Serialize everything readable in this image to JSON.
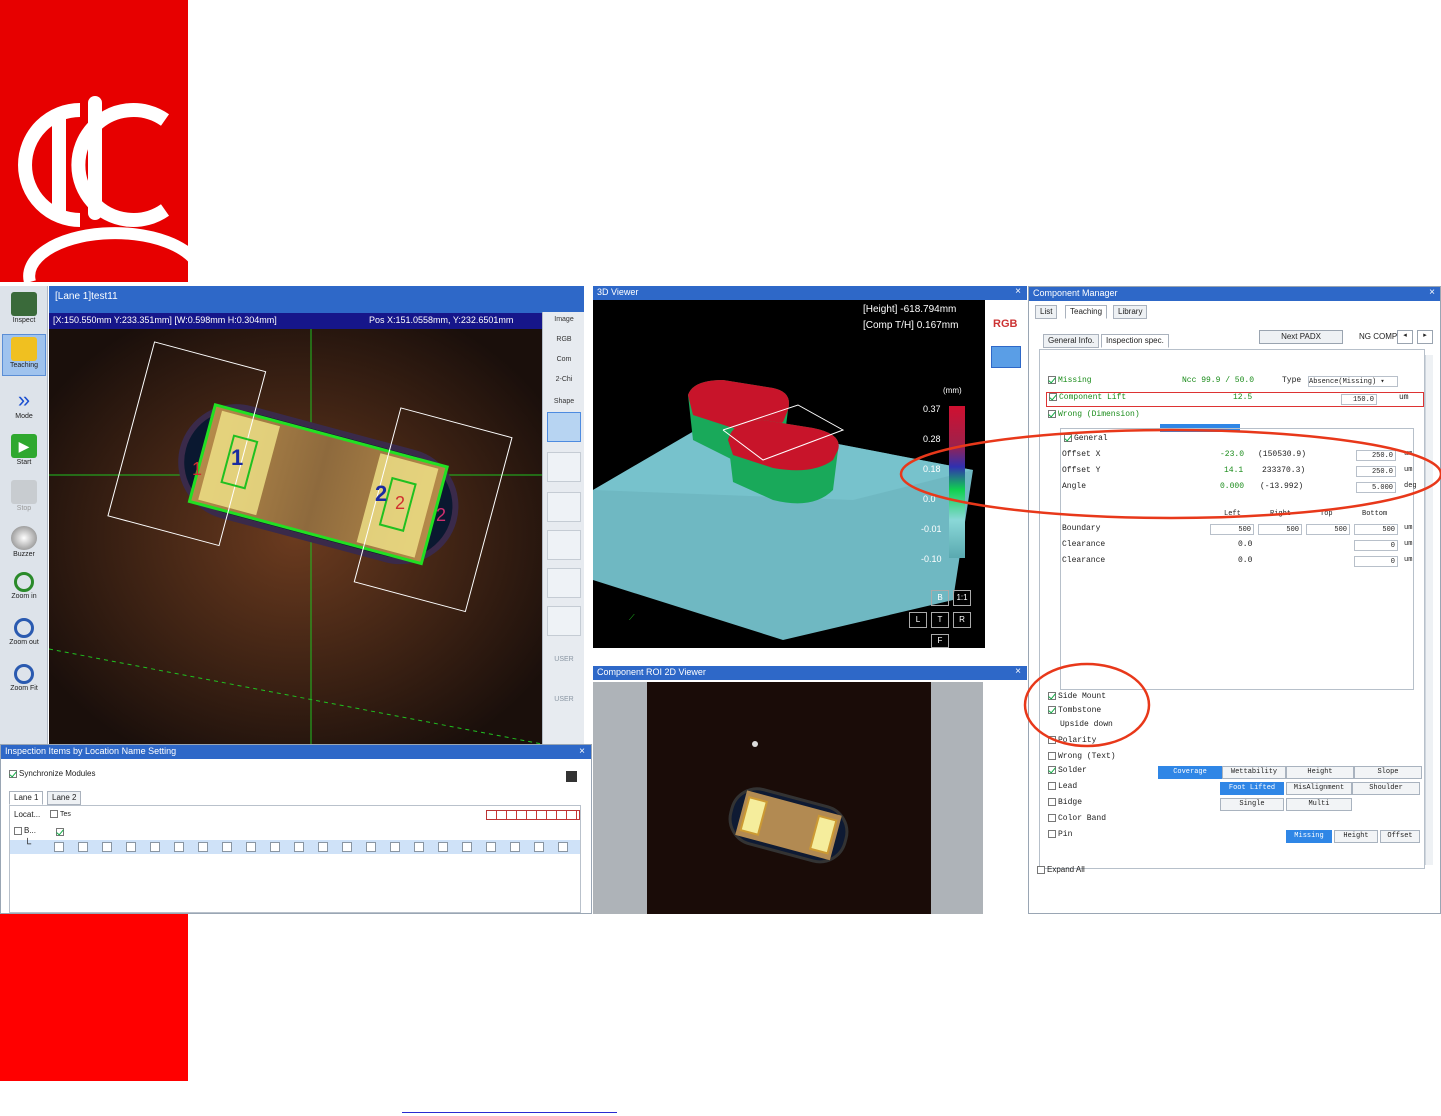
{
  "main_viewer": {
    "title": "[Lane 1]test11",
    "coords": "[X:150.550mm Y:233.351mm] [W:0.598mm H:0.304mm]",
    "pos": "Pos  X:151.0558mm, Y:232.6501mm",
    "pad_labels": [
      "1",
      "2",
      "1",
      "2",
      "2"
    ]
  },
  "toolbar": {
    "items": [
      {
        "label": "Inspect",
        "icon": "board-icon"
      },
      {
        "label": "Teaching",
        "icon": "teaching-icon"
      },
      {
        "label": "Mode",
        "icon": "double-chevron-icon"
      },
      {
        "label": "Start",
        "icon": "play-icon"
      },
      {
        "label": "Stop",
        "icon": "stop-icon"
      },
      {
        "label": "Buzzer",
        "icon": "buzzer-icon"
      },
      {
        "label": "Zoom in",
        "icon": "zoom-in-icon"
      },
      {
        "label": "Zoom out",
        "icon": "zoom-out-icon"
      },
      {
        "label": "Zoom Fit",
        "icon": "zoom-fit-icon"
      }
    ]
  },
  "side_tools": {
    "labels": [
      "Image",
      "RGB",
      "Com",
      "2-Chi",
      "Shape"
    ],
    "user1": "USER",
    "user2": "USER"
  },
  "inspection_items": {
    "title": "Inspection Items by Location Name Setting",
    "sync": "Synchronize Modules",
    "tabs": [
      "Lane 1",
      "Lane 2"
    ],
    "col_header": "Locat...",
    "col_test": "Tes",
    "row_label": "B..."
  },
  "viewer_3d": {
    "title": "3D Viewer",
    "height": "[Height] -618.794mm",
    "comp": "[Comp T/H]  0.167mm",
    "rgb": "RGB",
    "unit": "(mm)",
    "scale": [
      "0.37",
      "0.28",
      "0.18",
      "0.0",
      "-0.01",
      "-0.10"
    ],
    "views": [
      "B",
      "1:1",
      "L",
      "T",
      "R",
      "F"
    ]
  },
  "roi_viewer": {
    "title": "Component ROI 2D Viewer"
  },
  "component_manager": {
    "title": "Component Manager",
    "tabs": [
      "List",
      "Teaching",
      "Library"
    ],
    "subtabs": [
      "General Info.",
      "Inspection spec."
    ],
    "next_button": "Next PADX",
    "ng_label": "NG COMP",
    "missing": {
      "label": "Missing",
      "value": "Ncc 99.9 / 50.0",
      "type_label": "Type",
      "type": "Absence(Missing)"
    },
    "lift": {
      "label": "Component  Lift",
      "value": "12.5",
      "input": "150.0",
      "unit": "um"
    },
    "wrong_dim": "Wrong (Dimension)",
    "general": "General",
    "offset_x": {
      "label": "Offset X",
      "value": "-23.0",
      "paren": "(150530.9)",
      "input": "250.0",
      "unit": "um"
    },
    "offset_y": {
      "label": "Offset Y",
      "value": "14.1",
      "paren": "233370.3)",
      "input": "250.0",
      "unit": "um"
    },
    "angle": {
      "label": "Angle",
      "value": "0.000",
      "paren": "(-13.992)",
      "input": "5.000",
      "unit": "deg"
    },
    "cols": [
      "Left",
      "Right",
      "Top",
      "Bottom"
    ],
    "boundary": {
      "label": "Boundary",
      "values": [
        "500",
        "500",
        "500",
        "500"
      ],
      "unit": "um"
    },
    "clearance1": {
      "label": "Clearance",
      "value": "0.0",
      "input": "0",
      "unit": "um"
    },
    "clearance2": {
      "label": "Clearance",
      "value": "0.0",
      "input": "0",
      "unit": "um"
    },
    "side_mount": "Side Mount",
    "tombstone": "Tombstone",
    "upside": "Upside down",
    "polarity": "Polarity",
    "wrong_text": "Wrong (Text)",
    "solder": {
      "label": "Solder",
      "buttons": [
        "Coverage",
        "Wettability",
        "Height",
        "Slope"
      ]
    },
    "lead": {
      "label": "Lead",
      "buttons": [
        "Foot Lifted",
        "MisAlignment",
        "Shoulder"
      ]
    },
    "bridge": {
      "label": "Bidge",
      "buttons": [
        "Single",
        "Multi"
      ]
    },
    "color_band": "Color Band",
    "pin": {
      "label": "Pin",
      "buttons": [
        "Missing",
        "Height",
        "Offset"
      ]
    },
    "expand_all": "Expand All"
  },
  "colors": {
    "brand_red": "#ff0000",
    "title_blue": "#2e68c8",
    "annotation": "#e8381a"
  }
}
